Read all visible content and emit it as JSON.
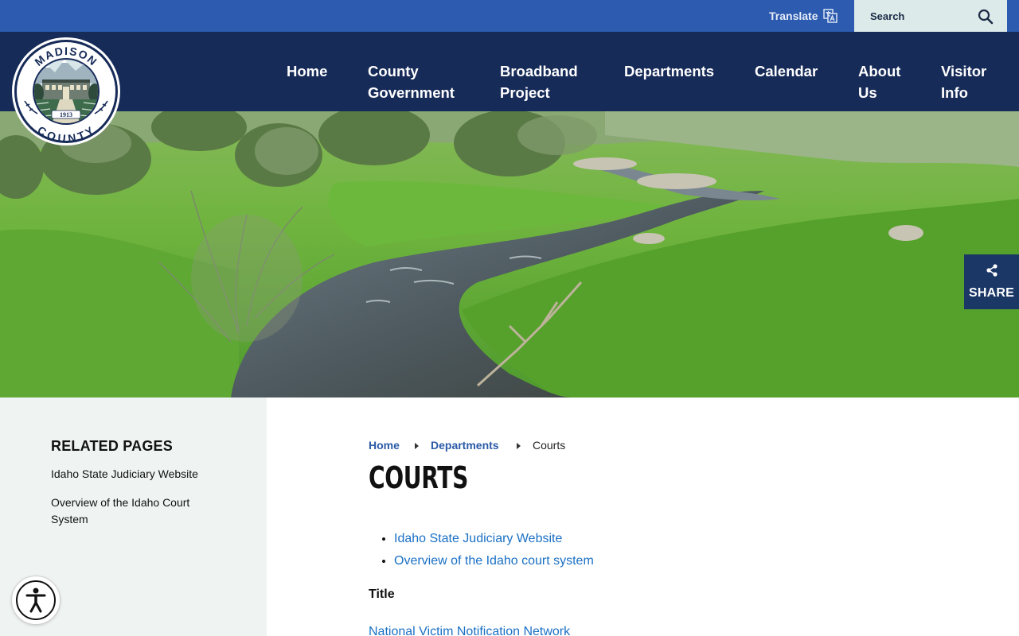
{
  "topbar": {
    "translate_label": "Translate",
    "search_placeholder": "Search"
  },
  "logo": {
    "top_text": "MADISON",
    "bottom_text": "COUNTY",
    "year": "1913"
  },
  "nav": {
    "items": [
      {
        "line1": "Home",
        "line2": ""
      },
      {
        "line1": "County",
        "line2": "Government"
      },
      {
        "line1": "Broadband",
        "line2": "Project"
      },
      {
        "line1": "Departments",
        "line2": ""
      },
      {
        "line1": "Calendar",
        "line2": ""
      },
      {
        "line1": "About",
        "line2": "Us"
      },
      {
        "line1": "Visitor",
        "line2": "Info"
      }
    ]
  },
  "share": {
    "label": "SHARE"
  },
  "sidebar": {
    "heading": "RELATED PAGES",
    "links": [
      "Idaho State Judiciary Website",
      "Overview of the Idaho Court System"
    ]
  },
  "breadcrumb": {
    "items": [
      "Home",
      "Departments"
    ],
    "current": "Courts"
  },
  "main": {
    "title": "COURTS",
    "links": [
      "Idaho State Judiciary Website",
      "Overview of the Idaho court system"
    ],
    "section_title": "Title",
    "table_link": "National Victim Notification Network"
  },
  "colors": {
    "topbar": "#2d5bb0",
    "header": "#172b58",
    "sidebar_bg": "#eff4f3",
    "link": "#1a70c4",
    "breadcrumb_link": "#2a5aa8"
  }
}
